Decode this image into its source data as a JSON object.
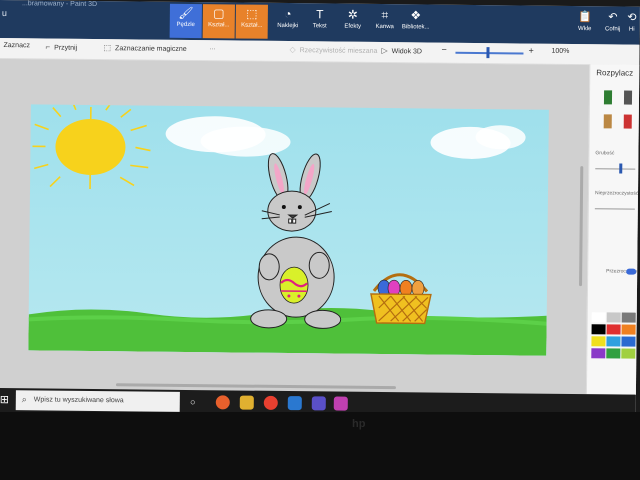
{
  "window": {
    "title_left": "u",
    "title_partial": "...bramowany - Paint 3D"
  },
  "ribbon": {
    "tabs": [
      {
        "label": "Pędzle",
        "icon": "brush-icon"
      },
      {
        "label": "Kształ...",
        "icon": "shapes2d-icon"
      },
      {
        "label": "Kształ...",
        "icon": "shapes3d-icon"
      },
      {
        "label": "Naklejki",
        "icon": "sticker-icon"
      },
      {
        "label": "Tekst",
        "icon": "text-icon"
      },
      {
        "label": "Efekty",
        "icon": "effects-icon"
      },
      {
        "label": "Kanwa",
        "icon": "canvas-icon"
      },
      {
        "label": "Bibliotek...",
        "icon": "library-icon"
      }
    ],
    "right": [
      {
        "label": "Wkle",
        "icon": "paste-icon"
      },
      {
        "label": "Cofnij",
        "icon": "undo-icon"
      },
      {
        "label": "Hi",
        "icon": "history-icon"
      }
    ]
  },
  "toolbar": {
    "select": "Zaznacz",
    "crop": "Przytnij",
    "magic": "Zaznaczanie magiczne",
    "mixed_reality": "Rzeczywistość mieszana",
    "view3d": "Widok 3D",
    "zoom": "100%",
    "minus": "−",
    "plus": "+",
    "more": "..."
  },
  "panel": {
    "title": "Rozpylacz",
    "thickness": "Grubość",
    "opacity": "Nieprzezroczystość",
    "transparent": "Przezroczysty"
  },
  "taskbar": {
    "search_placeholder": "Wpisz tu wyszukiwane słowa"
  },
  "brand": "hp",
  "colors": {
    "ribbon": "#1f3a5f",
    "active_tab": "#3f6fd8",
    "sky": "#a8e4ee",
    "grass": "#4fc03a",
    "sun": "#f7d21c",
    "bunny": "#c9c9c9",
    "basket": "#d69a1a"
  },
  "palette": [
    "#ffffff",
    "#c8c8c8",
    "#7a7a7a",
    "#000000",
    "#e03030",
    "#f08020",
    "#f0e020",
    "#30a0e0",
    "#2a6ad0",
    "#8a3ac8",
    "#30a040",
    "#a0d040"
  ]
}
